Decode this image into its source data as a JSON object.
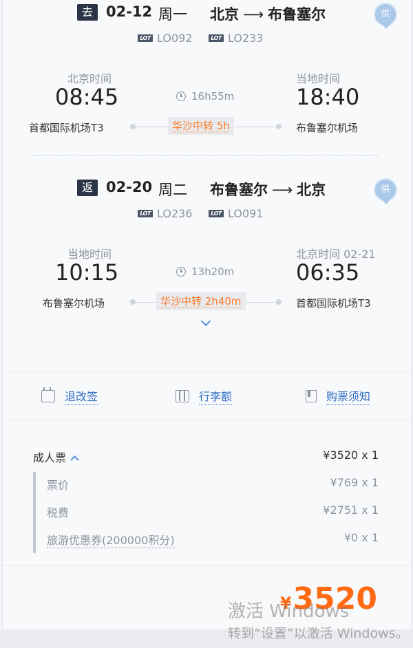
{
  "outbound": {
    "tag": "去",
    "date": "02-12",
    "weekday": "周一",
    "from_city": "北京",
    "to_city": "布鲁塞尔",
    "badge": "供",
    "flights": [
      "LO092",
      "LO233"
    ],
    "airline_logo": "LOT",
    "depart_label": "北京时间",
    "depart_time": "08:45",
    "depart_airport": "首都国际机场T3",
    "duration": "16h55m",
    "transfer": "华沙中转 5h",
    "arrive_label": "当地时间",
    "arrive_time": "18:40",
    "arrive_airport": "布鲁塞尔机场"
  },
  "inbound": {
    "tag": "返",
    "date": "02-20",
    "weekday": "周二",
    "from_city": "布鲁塞尔",
    "to_city": "北京",
    "badge": "供",
    "flights": [
      "LO236",
      "LO091"
    ],
    "airline_logo": "LOT",
    "depart_label": "当地时间",
    "depart_time": "10:15",
    "depart_airport": "布鲁塞尔机场",
    "duration": "13h20m",
    "transfer": "华沙中转 2h40m",
    "arrive_label": "北京时间  02-21",
    "arrive_time": "06:35",
    "arrive_airport": "首都国际机场T3"
  },
  "actions": {
    "refund": "退改签",
    "baggage": "行李额",
    "notice": "购票须知"
  },
  "price": {
    "adult_label": "成人票",
    "adult_value": "¥3520 x 1",
    "fare_label": "票价",
    "fare_value": "¥769 x 1",
    "tax_label": "税费",
    "tax_value": "¥2751 x 1",
    "coupon_label": "旅游优惠券(200000积分)",
    "coupon_value": "¥0 x 1",
    "currency": "¥",
    "total": "3520"
  },
  "watermark": {
    "line1": "激活 Windows",
    "line2": "转到“设置”以激活 Windows。"
  },
  "colors": {
    "accent_orange": "#ff6a13",
    "link_blue": "#2d6ec4",
    "tag_dark": "#2c3447"
  }
}
